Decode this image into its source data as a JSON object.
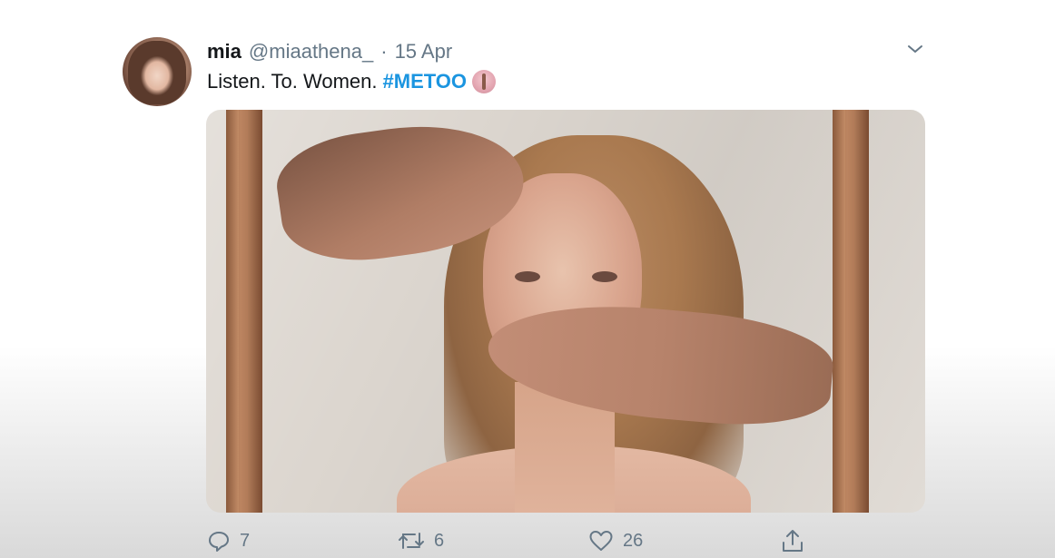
{
  "tweet": {
    "author_name": "mia",
    "handle": "@miaathena_",
    "separator": "·",
    "date": "15 Apr",
    "text_prefix": "Listen. To. Women.",
    "hashtag": "#METOO"
  },
  "actions": {
    "replies": "7",
    "retweets": "6",
    "likes": "26"
  },
  "icons": {
    "reply": "reply-icon",
    "retweet": "retweet-icon",
    "like": "heart-icon",
    "share": "share-icon",
    "menu": "chevron-down-icon"
  },
  "colors": {
    "hashtag": "#1b95e0",
    "secondary_text": "#657786",
    "primary_text": "#14171a"
  }
}
